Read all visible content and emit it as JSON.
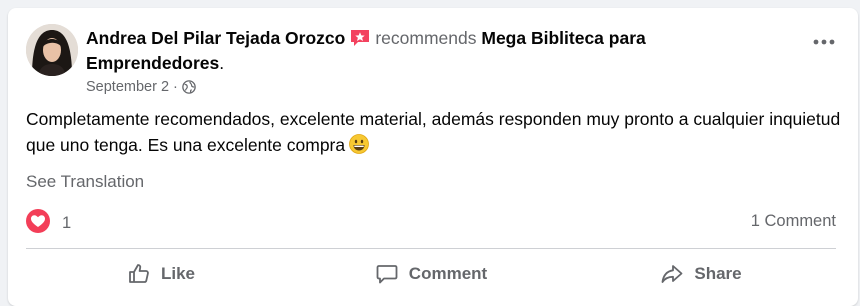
{
  "post": {
    "author": "Andrea Del Pilar Tejada Orozco",
    "recommends_label": "recommends",
    "page_name": "Mega Bibliteca para Emprendedores",
    "period": ".",
    "date": "September 2",
    "separator": "·",
    "privacy_icon": "globe-icon",
    "text": "Completamente recomendados, excelente material, además responden muy pronto a cualquier inquietud que uno tenga. Es una excelente compra",
    "see_translation": "See Translation"
  },
  "stats": {
    "reaction_count": "1",
    "comment_count": "1 Comment"
  },
  "actions": {
    "like": "Like",
    "comment": "Comment",
    "share": "Share"
  },
  "colors": {
    "recommend_badge": "#f3425f",
    "reaction_heart": "#f33e58",
    "secondary_text": "#65676b",
    "divider": "#ced0d4"
  }
}
